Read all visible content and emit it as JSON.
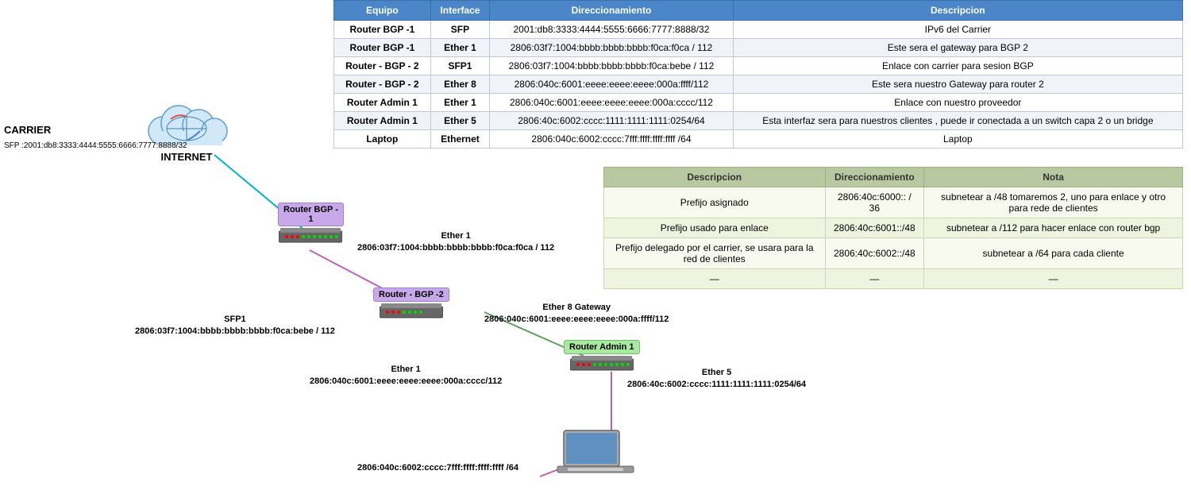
{
  "tables": {
    "main": {
      "headers": [
        "Equipo",
        "Interface",
        "Direccionamiento",
        "Descripcion"
      ],
      "rows": [
        [
          "Router BGP -1",
          "SFP",
          "2001:db8:3333:4444:5555:6666:7777:8888/32",
          "IPv6 del Carrier"
        ],
        [
          "Router BGP -1",
          "Ether 1",
          "2806:03f7:1004:bbbb:bbbb:bbbb:f0ca:f0ca / 112",
          "Este sera el gateway para BGP 2"
        ],
        [
          "Router - BGP - 2",
          "SFP1",
          "2806:03f7:1004:bbbb:bbbb:bbbb:f0ca:bebe / 112",
          "Enlace con carrier para sesion BGP"
        ],
        [
          "Router - BGP - 2",
          "Ether 8",
          "2806:040c:6001:eeee:eeee:eeee:000a:ffff/112",
          "Este sera nuestro Gateway para router 2"
        ],
        [
          "Router Admin 1",
          "Ether 1",
          "2806:040c:6001:eeee:eeee:eeee:000a:cccc/112",
          "Enlace con nuestro proveedor"
        ],
        [
          "Router Admin 1",
          "Ether 5",
          "2806:40c:6002:cccc:1111:1111:1111:0254/64",
          "Esta interfaz sera para nuestros clientes , puede ir conectada a un switch capa 2 o un bridge"
        ],
        [
          "Laptop",
          "Ethernet",
          "2806:040c:6002:cccc:7fff:ffff:ffff:ffff /64",
          "Laptop"
        ]
      ]
    },
    "second": {
      "headers": [
        "Descripcion",
        "Direccionamiento",
        "Nota"
      ],
      "rows": [
        [
          "Prefijo asignado",
          "2806:40c:6000:: / 36",
          "subnetear a /48  tomaremos 2, uno para enlace y otro para rede de clientes"
        ],
        [
          "Prefijo usado para enlace",
          "2806:40c:6001::/48",
          "subnetear a /112 para hacer enlace con router bgp"
        ],
        [
          "Prefijo delegado por el carrier, se usara para la red de clientes",
          "2806:40c:6002::/48",
          "subnetear a /64 para cada cliente"
        ],
        [
          "—",
          "—",
          "—"
        ]
      ]
    }
  },
  "diagram": {
    "internet_label": "INTERNET",
    "carrier_label": "CARRIER",
    "carrier_sfp": "SFP :2001:db8:3333:4444:5555:6666:7777:8888/32",
    "router_bgp1_label": "Router BGP -\n1",
    "router_bgp2_label": "Router - BGP -2",
    "router_admin1_label": "Router Admin 1",
    "ether1_label": "Ether 1",
    "ether1_addr": "2806:03f7:1004:bbbb:bbbb:bbbb:f0ca:f0ca / 112",
    "sfp1_label": "SFP1",
    "sfp1_addr": "2806:03f7:1004:bbbb:bbbb:bbbb:f0ca:bebe / 112",
    "ether8_label": "Ether 8 Gateway",
    "ether8_addr": "2806:040c:6001:eeee:eeee:eeee:000a:ffff/112",
    "ether1b_label": "Ether 1",
    "ether1b_addr": "2806:040c:6001:eeee:eeee:eeee:000a:cccc/112",
    "ether5_label": "Ether 5",
    "ether5_addr": "2806:40c:6002:cccc:1111:1111:1111:0254/64",
    "laptop_addr": "2806:040c:6002:cccc:7fff:ffff:ffff:ffff /64",
    "laptop_label": "Laptop"
  }
}
